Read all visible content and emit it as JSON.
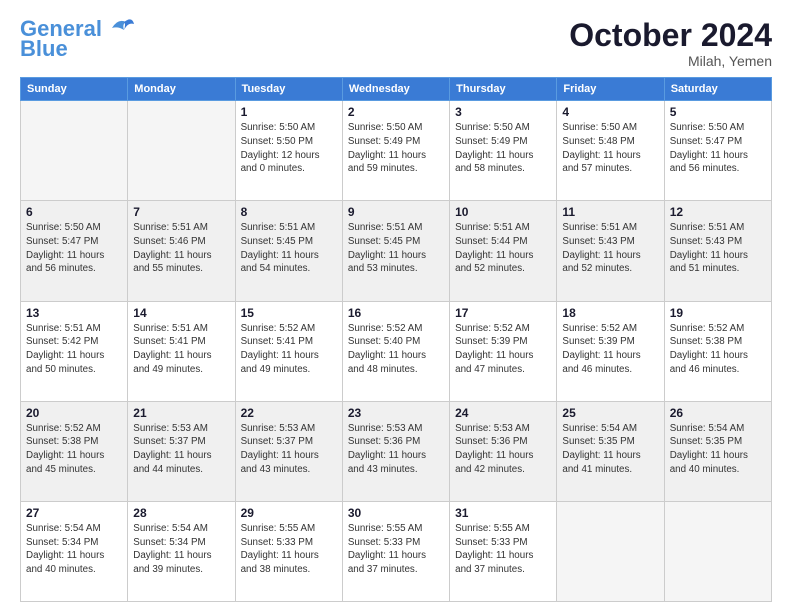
{
  "logo": {
    "line1": "General",
    "line2": "Blue",
    "bird": true
  },
  "title": "October 2024",
  "location": "Milah, Yemen",
  "days_of_week": [
    "Sunday",
    "Monday",
    "Tuesday",
    "Wednesday",
    "Thursday",
    "Friday",
    "Saturday"
  ],
  "weeks": [
    [
      {
        "num": "",
        "empty": true
      },
      {
        "num": "",
        "empty": true
      },
      {
        "num": "1",
        "sunrise": "5:50 AM",
        "sunset": "5:50 PM",
        "daylight": "12 hours and 0 minutes."
      },
      {
        "num": "2",
        "sunrise": "5:50 AM",
        "sunset": "5:49 PM",
        "daylight": "11 hours and 59 minutes."
      },
      {
        "num": "3",
        "sunrise": "5:50 AM",
        "sunset": "5:49 PM",
        "daylight": "11 hours and 58 minutes."
      },
      {
        "num": "4",
        "sunrise": "5:50 AM",
        "sunset": "5:48 PM",
        "daylight": "11 hours and 57 minutes."
      },
      {
        "num": "5",
        "sunrise": "5:50 AM",
        "sunset": "5:47 PM",
        "daylight": "11 hours and 56 minutes."
      }
    ],
    [
      {
        "num": "6",
        "sunrise": "5:50 AM",
        "sunset": "5:47 PM",
        "daylight": "11 hours and 56 minutes."
      },
      {
        "num": "7",
        "sunrise": "5:51 AM",
        "sunset": "5:46 PM",
        "daylight": "11 hours and 55 minutes."
      },
      {
        "num": "8",
        "sunrise": "5:51 AM",
        "sunset": "5:45 PM",
        "daylight": "11 hours and 54 minutes."
      },
      {
        "num": "9",
        "sunrise": "5:51 AM",
        "sunset": "5:45 PM",
        "daylight": "11 hours and 53 minutes."
      },
      {
        "num": "10",
        "sunrise": "5:51 AM",
        "sunset": "5:44 PM",
        "daylight": "11 hours and 52 minutes."
      },
      {
        "num": "11",
        "sunrise": "5:51 AM",
        "sunset": "5:43 PM",
        "daylight": "11 hours and 52 minutes."
      },
      {
        "num": "12",
        "sunrise": "5:51 AM",
        "sunset": "5:43 PM",
        "daylight": "11 hours and 51 minutes."
      }
    ],
    [
      {
        "num": "13",
        "sunrise": "5:51 AM",
        "sunset": "5:42 PM",
        "daylight": "11 hours and 50 minutes."
      },
      {
        "num": "14",
        "sunrise": "5:51 AM",
        "sunset": "5:41 PM",
        "daylight": "11 hours and 49 minutes."
      },
      {
        "num": "15",
        "sunrise": "5:52 AM",
        "sunset": "5:41 PM",
        "daylight": "11 hours and 49 minutes."
      },
      {
        "num": "16",
        "sunrise": "5:52 AM",
        "sunset": "5:40 PM",
        "daylight": "11 hours and 48 minutes."
      },
      {
        "num": "17",
        "sunrise": "5:52 AM",
        "sunset": "5:39 PM",
        "daylight": "11 hours and 47 minutes."
      },
      {
        "num": "18",
        "sunrise": "5:52 AM",
        "sunset": "5:39 PM",
        "daylight": "11 hours and 46 minutes."
      },
      {
        "num": "19",
        "sunrise": "5:52 AM",
        "sunset": "5:38 PM",
        "daylight": "11 hours and 46 minutes."
      }
    ],
    [
      {
        "num": "20",
        "sunrise": "5:52 AM",
        "sunset": "5:38 PM",
        "daylight": "11 hours and 45 minutes."
      },
      {
        "num": "21",
        "sunrise": "5:53 AM",
        "sunset": "5:37 PM",
        "daylight": "11 hours and 44 minutes."
      },
      {
        "num": "22",
        "sunrise": "5:53 AM",
        "sunset": "5:37 PM",
        "daylight": "11 hours and 43 minutes."
      },
      {
        "num": "23",
        "sunrise": "5:53 AM",
        "sunset": "5:36 PM",
        "daylight": "11 hours and 43 minutes."
      },
      {
        "num": "24",
        "sunrise": "5:53 AM",
        "sunset": "5:36 PM",
        "daylight": "11 hours and 42 minutes."
      },
      {
        "num": "25",
        "sunrise": "5:54 AM",
        "sunset": "5:35 PM",
        "daylight": "11 hours and 41 minutes."
      },
      {
        "num": "26",
        "sunrise": "5:54 AM",
        "sunset": "5:35 PM",
        "daylight": "11 hours and 40 minutes."
      }
    ],
    [
      {
        "num": "27",
        "sunrise": "5:54 AM",
        "sunset": "5:34 PM",
        "daylight": "11 hours and 40 minutes."
      },
      {
        "num": "28",
        "sunrise": "5:54 AM",
        "sunset": "5:34 PM",
        "daylight": "11 hours and 39 minutes."
      },
      {
        "num": "29",
        "sunrise": "5:55 AM",
        "sunset": "5:33 PM",
        "daylight": "11 hours and 38 minutes."
      },
      {
        "num": "30",
        "sunrise": "5:55 AM",
        "sunset": "5:33 PM",
        "daylight": "11 hours and 37 minutes."
      },
      {
        "num": "31",
        "sunrise": "5:55 AM",
        "sunset": "5:33 PM",
        "daylight": "11 hours and 37 minutes."
      },
      {
        "num": "",
        "empty": true
      },
      {
        "num": "",
        "empty": true
      }
    ]
  ]
}
